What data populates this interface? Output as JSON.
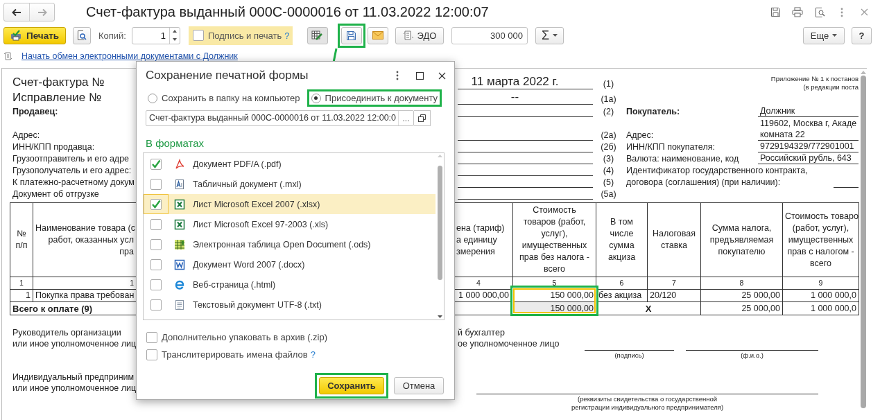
{
  "window": {
    "title": "Счет-фактура выданный 000С-0000016 от 11.03.2022 12:00:07"
  },
  "toolbar": {
    "print_button": "Печать",
    "copies_label": "Копий:",
    "copies_value": "1",
    "sign_and_print": {
      "label": "Подпись и печать",
      "checked": false,
      "help": "?"
    },
    "save_highlighted": true,
    "edo_button": "ЭДО",
    "sum_value": "300 000",
    "sum_button": "Σ",
    "more_button": "Еще",
    "help_button": "?"
  },
  "pointer_arrow": true,
  "exchange_link": "Начать обмен электронными документами с Должник",
  "document": {
    "note": [
      "Приложение № 1 к постанов",
      "(в редакции поста"
    ],
    "header_rows": [
      {
        "kind": "title",
        "left": "Счет-фактура №",
        "value": "11 марта 2022 г.",
        "code": "(1)"
      },
      {
        "kind": "title",
        "left": "Исправление №",
        "value": "--",
        "code": "(1а)"
      },
      {
        "kind": "party",
        "left": "Продавец:",
        "code": "(2)",
        "right_label": "Покупатель:",
        "right_value": [
          "Должник"
        ]
      },
      {
        "kind": "field",
        "left": "Адрес:",
        "code": "(2а)",
        "right_label": "Адрес:",
        "right_value": [
          "119602, Москва г, Акаде",
          "комната 22"
        ]
      },
      {
        "kind": "field",
        "left": "ИНН/КПП продавца:",
        "code": "(2б)",
        "right_label": "ИНН/КПП покупателя:",
        "right_value": [
          "9729194329/772901001"
        ]
      },
      {
        "kind": "field",
        "left": "Грузоотправитель и его адре",
        "code": "(3)",
        "right_label": "Валюта: наименование, код",
        "right_value": [
          "Российский рубль, 643"
        ]
      },
      {
        "kind": "field",
        "left": "Грузополучатель и его адрес:",
        "code": "(4)",
        "right_label": "Идентификатор государственного контракта,"
      },
      {
        "kind": "field",
        "left": "К платежно-расчетному докум",
        "code": "(5)",
        "right_label": "договора (соглашения) (при наличии):",
        "right_blank": true
      },
      {
        "kind": "field",
        "left": "Документ об отгрузке",
        "code": "(5а)"
      }
    ],
    "table": {
      "columns": [
        "№\nп/п",
        "Наименование товара (с\nработ, оказанных усл\nпра",
        "ена (тариф)\nа единицу\nзмерения",
        "Стоимость\nтоваров (работ,\nуслуг),\nимущественных\nправ без налога -\nвсего",
        "В том\nчисле\nсумма\nакциза",
        "Налоговая\nставка",
        "Сумма налога,\nпредъявляемая\nпокупателю",
        "Стоимость товаро\n(работ, услуг),\nимущественных\nправ с налогом -\nвсего"
      ],
      "column_numbers": [
        "1",
        "1",
        "4",
        "5",
        "6",
        "7",
        "8",
        "9"
      ],
      "rows": [
        [
          "1",
          "Покупка права требован",
          "1 000 000,00",
          "150 000,00",
          "без акциза",
          "20/120",
          "25 000,00",
          "1 000 000,0"
        ]
      ],
      "total": {
        "label": "Всего к оплате (9)",
        "cost": "150 000,00",
        "mark": "X",
        "tax": "25 000,00",
        "sum": "1 000 000,0"
      },
      "cost_highlighted": true
    },
    "signatures": {
      "head": [
        "Руководитель организации",
        "или иное уполномоченное лиц"
      ],
      "accountant": [
        "й бухгалтер",
        "ое уполномоченное лицо"
      ],
      "sign_caption": "(подпись)",
      "name_caption": "(ф.и.о.)",
      "entrepreneur": [
        "Индивидуальный предприним",
        "или иное уполномоченное лиц"
      ],
      "certificate_caption": "(реквизиты свидетельства о государственной\nрегистрации индивидуального предпринимателя)"
    }
  },
  "dialog": {
    "title": "Сохранение печатной формы",
    "targets": [
      {
        "label": "Сохранить в папку на компьютер",
        "selected": false,
        "highlighted": false
      },
      {
        "label": "Присоединить к документу",
        "selected": true,
        "highlighted": true
      }
    ],
    "file_name": "Счет-фактура выданный 000С-0000016 от 11.03.2022 12:00:0",
    "choose_button": "...",
    "formats_heading": "В форматах",
    "formats": [
      {
        "label": "Документ PDF/A (.pdf)",
        "kind": "pdf",
        "checked": true,
        "selected": false
      },
      {
        "label": "Табличный документ (.mxl)",
        "kind": "mxl",
        "checked": false,
        "selected": false
      },
      {
        "label": "Лист Microsoft Excel 2007 (.xlsx)",
        "kind": "excel",
        "checked": true,
        "selected": true
      },
      {
        "label": "Лист Microsoft Excel 97-2003 (.xls)",
        "kind": "excel",
        "checked": false,
        "selected": false
      },
      {
        "label": "Электронная таблица Open Document (.ods)",
        "kind": "ods",
        "checked": false,
        "selected": false
      },
      {
        "label": "Документ Word 2007 (.docx)",
        "kind": "word",
        "checked": false,
        "selected": false
      },
      {
        "label": "Веб-страница (.html)",
        "kind": "web",
        "checked": false,
        "selected": false
      },
      {
        "label": "Текстовый документ UTF-8 (.txt)",
        "kind": "text",
        "checked": false,
        "selected": false
      }
    ],
    "options": [
      {
        "label": "Дополнительно упаковать в архив (.zip)",
        "checked": false
      },
      {
        "label": "Транслитерировать имена файлов",
        "checked": false,
        "help": "?"
      }
    ],
    "save_button": {
      "label": "Сохранить",
      "highlighted": true
    },
    "cancel_button": "Отмена"
  }
}
